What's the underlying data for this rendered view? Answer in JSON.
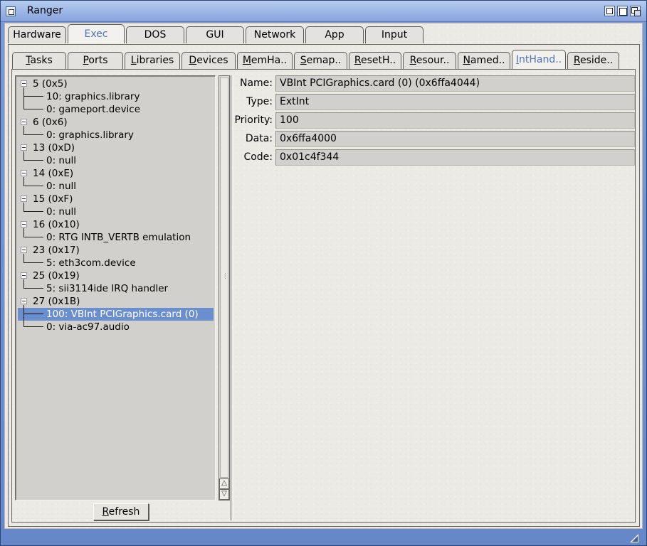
{
  "window": {
    "title": "Ranger"
  },
  "main_tabs": [
    {
      "label": "Hardware",
      "active": false
    },
    {
      "label": "Exec",
      "active": true
    },
    {
      "label": "DOS",
      "active": false
    },
    {
      "label": "GUI",
      "active": false
    },
    {
      "label": "Network",
      "active": false
    },
    {
      "label": "App",
      "active": false
    },
    {
      "label": "Input",
      "active": false
    }
  ],
  "sub_tabs": [
    {
      "label": "Tasks",
      "active": false
    },
    {
      "label": "Ports",
      "active": false
    },
    {
      "label": "Libraries",
      "active": false
    },
    {
      "label": "Devices",
      "active": false
    },
    {
      "label": "MemHa..",
      "active": false
    },
    {
      "label": "Semap..",
      "active": false
    },
    {
      "label": "ResetH..",
      "active": false
    },
    {
      "label": "Resour..",
      "active": false
    },
    {
      "label": "Named..",
      "active": false
    },
    {
      "label": "IntHand..",
      "active": true
    },
    {
      "label": "Reside..",
      "active": false
    }
  ],
  "tree": [
    {
      "label": "5 (0x5)",
      "children": [
        "10: graphics.library",
        "0: gameport.device"
      ]
    },
    {
      "label": "6 (0x6)",
      "children": [
        "0: graphics.library"
      ]
    },
    {
      "label": "13 (0xD)",
      "children": [
        "0: null"
      ]
    },
    {
      "label": "14 (0xE)",
      "children": [
        "0: null"
      ]
    },
    {
      "label": "15 (0xF)",
      "children": [
        "0: null"
      ]
    },
    {
      "label": "16 (0x10)",
      "children": [
        "0: RTG INTB_VERTB emulation"
      ]
    },
    {
      "label": "23 (0x17)",
      "children": [
        "5: eth3com.device"
      ]
    },
    {
      "label": "25 (0x19)",
      "children": [
        "5: sii3114ide IRQ handler"
      ]
    },
    {
      "label": "27 (0x1B)",
      "children": [
        "100: VBInt PCIGraphics.card (0)",
        "0: via-ac97.audio"
      ]
    }
  ],
  "selected_item": "100: VBInt PCIGraphics.card (0)",
  "refresh_label": "Refresh",
  "details": [
    {
      "label": "Name:",
      "value": "VBInt PCIGraphics.card (0) (0x6ffa4044)"
    },
    {
      "label": "Type:",
      "value": "ExtInt"
    },
    {
      "label": "Priority:",
      "value": "100"
    },
    {
      "label": "Data:",
      "value": "0x6ffa4000"
    },
    {
      "label": "Code:",
      "value": "0x01c4f344"
    }
  ],
  "colors": {
    "accent": "#4f74b8",
    "selection": "#6b8fce",
    "title_bar": "#9db7e6"
  }
}
